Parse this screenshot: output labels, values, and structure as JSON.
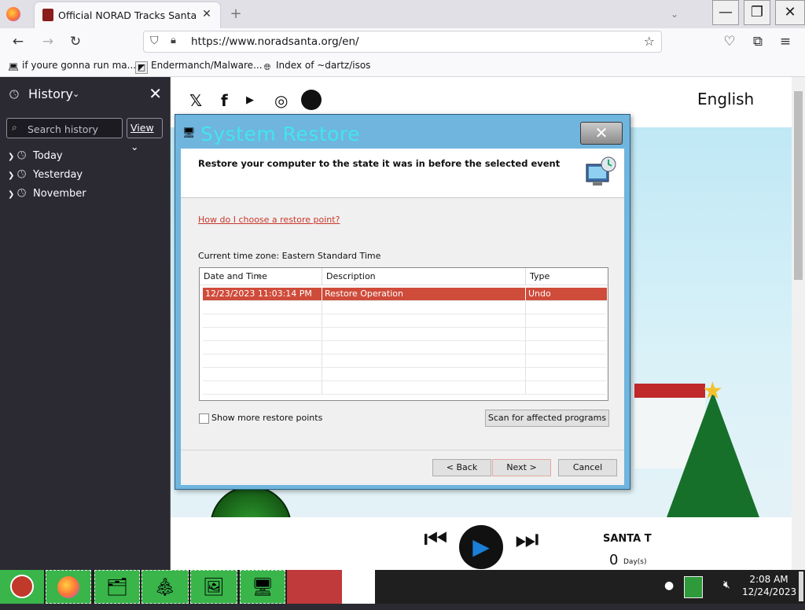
{
  "browser": {
    "tab_title": "Official NORAD Tracks Santa",
    "url": "https://www.noradsanta.org/en/",
    "bookmarks": [
      {
        "label": "if youre gonna run ma..."
      },
      {
        "label": "Endermanch/Malware..."
      },
      {
        "label": "Index of ~dartz/isos"
      }
    ]
  },
  "sidebar": {
    "title": "History",
    "search_placeholder": "Search history",
    "view_label": "View",
    "items": [
      {
        "label": "Today"
      },
      {
        "label": "Yesterday"
      },
      {
        "label": "November"
      }
    ]
  },
  "page": {
    "language": "English",
    "santa_label": "SANTA T",
    "days_value": "0",
    "days_label": "Day(s)"
  },
  "dialog": {
    "title": "System Restore",
    "heading": "Restore your computer to the state it was in before the selected event",
    "help_link": "How do I choose a restore point?",
    "timezone": "Current time zone: Eastern Standard Time",
    "columns": [
      "Date and Time",
      "Description",
      "Type"
    ],
    "rows": [
      {
        "date": "12/23/2023 11:03:14 PM",
        "description": "Restore Operation",
        "type": "Undo"
      }
    ],
    "show_more_label": "Show more restore points",
    "show_more_checked": false,
    "scan_button": "Scan for affected programs",
    "back_button": "< Back",
    "next_button": "Next >",
    "cancel_button": "Cancel"
  },
  "taskbar": {
    "time": "2:08 AM",
    "date": "12/24/2023"
  },
  "colors": {
    "selection": "#cf4b3a",
    "taskbar_button": "#39b54a",
    "dialog_title": "#44e4ee"
  }
}
